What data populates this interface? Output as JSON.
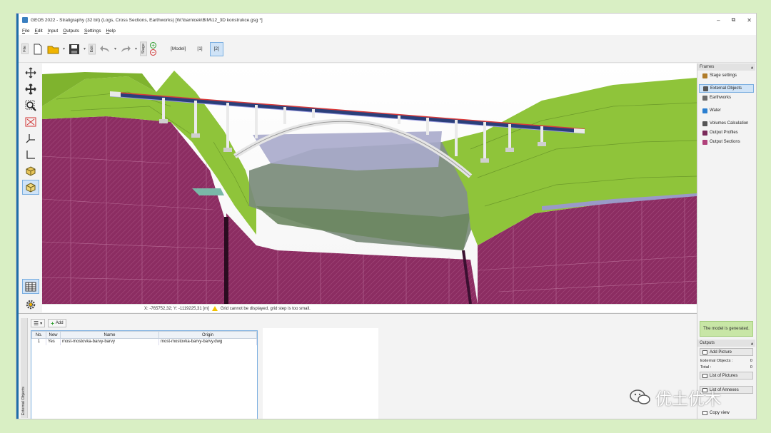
{
  "window": {
    "title": "GEO5 2022 - Stratigraphy (32 bit) (Logs, Cross Sections, Earthworks) [W:\\barnicek\\BIM\\12_3D konstrukce.gsg *]",
    "controls": [
      "–",
      "⧉",
      "✕"
    ]
  },
  "menu": [
    "File",
    "Edit",
    "Input",
    "Outputs",
    "Settings",
    "Help"
  ],
  "toolbar": {
    "file_label": "File",
    "edit_label": "Edit",
    "stage_label": "Stage",
    "stages": [
      "[Model]",
      "[1]",
      "[2]"
    ],
    "selected_stage": "[2]"
  },
  "status": {
    "coords": "X: -765752,32; Y: -1119225,31 [m]",
    "message": "Grid cannot be displayed, grid step is too small."
  },
  "sidebar": {
    "frames_header": "Frames",
    "frames": [
      {
        "label": "Stage settings",
        "icon": "stage-settings-icon",
        "color": "#b07c2a"
      },
      {
        "label": "External Objects",
        "icon": "external-objects-icon",
        "color": "#555555"
      },
      {
        "label": "Earthworks",
        "icon": "earthworks-icon",
        "color": "#6b6b6b"
      },
      {
        "label": "Water",
        "icon": "water-icon",
        "color": "#2b7fd0"
      },
      {
        "label": "Volumes Calculation",
        "icon": "volumes-icon",
        "color": "#555555"
      },
      {
        "label": "Output Profiles",
        "icon": "output-profiles-icon",
        "color": "#7a2a5a"
      },
      {
        "label": "Output Sections",
        "icon": "output-sections-icon",
        "color": "#b0407a"
      }
    ],
    "selected_frame": "External Objects",
    "generated": "The model is generated.",
    "outputs_header": "Outputs",
    "add_picture": "Add Picture",
    "external_objects_label": "External Objects :",
    "external_objects_value": "0",
    "total_label": "Total :",
    "total_value": "0",
    "list_of_pictures": "List of Pictures",
    "list_of_annexes": "List of Annexes",
    "copy_view": "Copy view"
  },
  "bottom": {
    "panel_label": "External Objects",
    "add_label": "Add",
    "columns": [
      "No.",
      "New",
      "Name",
      "Origin"
    ],
    "rows": [
      {
        "no": "1",
        "new": "Yes",
        "name": "most-mostovka-barvy-barvy",
        "origin": "most-mostovka-barvy-barvy.dwg"
      }
    ]
  },
  "watermark": "优土优木",
  "colors": {
    "accent": "#1d6ea8",
    "terrain": "#8fc43a",
    "rock": "#8a2a5e",
    "selection": "#cfe3f7",
    "generated": "#c8e6a6"
  }
}
